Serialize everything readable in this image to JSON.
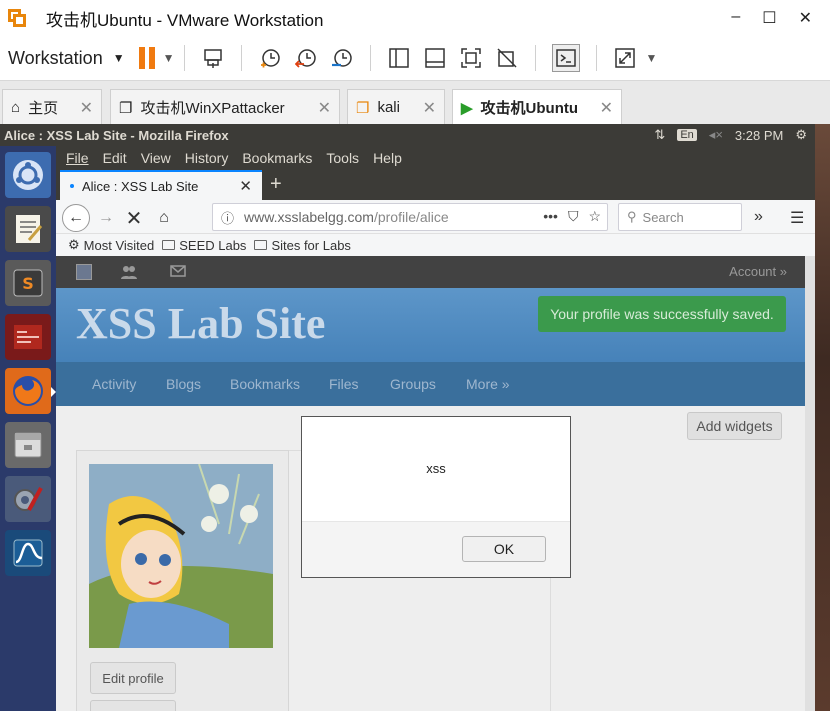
{
  "vmware": {
    "window_title": "攻击机Ubuntu - VMware Workstation",
    "controls": {
      "minimize": "–",
      "maximize": "☐",
      "close": "✕"
    },
    "toolbar": {
      "workstation_label": "Workstation"
    },
    "tabs": [
      {
        "label": "主页",
        "icon": "home-icon",
        "active": false
      },
      {
        "label": "攻击机WinXPattacker",
        "icon": "vm-icon",
        "active": false
      },
      {
        "label": "kali",
        "icon": "vm-icon",
        "active": false
      },
      {
        "label": "攻击机Ubuntu",
        "icon": "vm-running-icon",
        "active": true
      }
    ]
  },
  "ubuntu": {
    "window_title": "Alice : XSS Lab Site - Mozilla Firefox",
    "status": {
      "input": "En",
      "volume": "◂×",
      "time": "3:28 PM",
      "network_glyph": "⇅",
      "gear_glyph": "⚙"
    }
  },
  "firefox": {
    "menu": [
      "File",
      "Edit",
      "View",
      "History",
      "Bookmarks",
      "Tools",
      "Help"
    ],
    "tab": {
      "title": "Alice : XSS Lab Site",
      "close": "✕",
      "new_tab": "+"
    },
    "url": {
      "host": "www.xsslabelgg.com",
      "path": "/profile/alice"
    },
    "search_placeholder": "Search",
    "bookmarks": [
      "Most Visited",
      "SEED Labs",
      "Sites for Labs"
    ]
  },
  "page": {
    "account": "Account »",
    "site_title": "XSS Lab Site",
    "success_message": "Your profile was successfully saved.",
    "nav": [
      "Activity",
      "Blogs",
      "Bookmarks",
      "Files",
      "Groups",
      "More »"
    ],
    "add_widgets": "Add widgets",
    "edit_profile": "Edit profile"
  },
  "alert": {
    "message": "xss",
    "ok": "OK"
  },
  "colors": {
    "vmware_orange": "#f07a10",
    "ubuntu_panel": "#3c3b37",
    "launcher": "#2b3a6a",
    "elgg_header": "#4a89c1",
    "success_green": "#3b9a4c"
  }
}
